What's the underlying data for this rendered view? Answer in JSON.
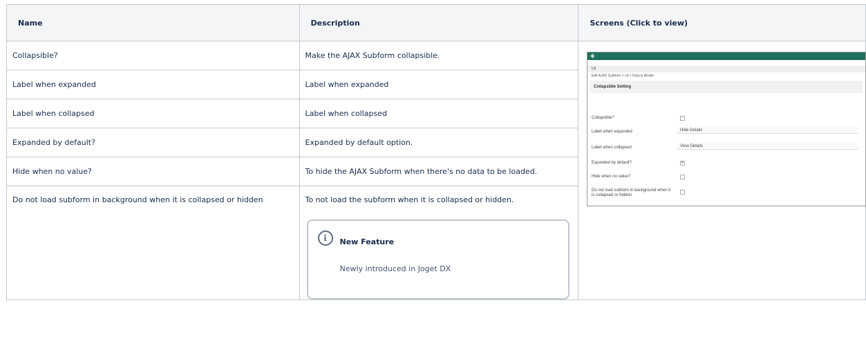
{
  "headers": [
    "Name",
    "Description",
    "Screens (Click to view)"
  ],
  "rows": [
    {
      "name": "Collapsible?",
      "description": "Make the AJAX Subform collapsible."
    },
    {
      "name": "Label when expanded",
      "description": "Label when expanded"
    },
    {
      "name": "Label when collapsed",
      "description": "Label when collapsed"
    },
    {
      "name": "Expanded by default?",
      "description": "Expanded by default option."
    },
    {
      "name": "Hide when no value?",
      "description": "To hide the AJAX Subform when there's no data to be loaded."
    },
    {
      "name": "Do not load subform in background when it is collapsed or hidden",
      "description": "To not load the subform when it is collapsed or hidden."
    }
  ],
  "info_panel": {
    "icon": "info-icon",
    "title": "New Feature",
    "body": "Newly introduced in Joget DX"
  },
  "screenshot": {
    "title": "UI",
    "breadcrumb": "Edit AJAX Subform > UI > Data & Binder",
    "section": "Collapsible Setting",
    "fields": [
      {
        "label": "Collapsible?",
        "value": ""
      },
      {
        "label": "Label when expanded",
        "value": "Hide Details"
      },
      {
        "label": "Label when collapsed",
        "value": "View Details"
      },
      {
        "label": "Expanded by default?",
        "value": "✔"
      },
      {
        "label": "Hide when no value?",
        "value": ""
      },
      {
        "label": "Do not load subform in background when it is collapsed or hidden",
        "value": ""
      }
    ]
  }
}
